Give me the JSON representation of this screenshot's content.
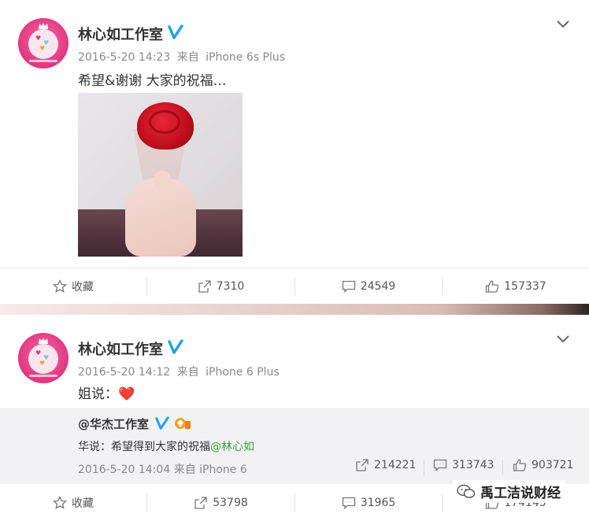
{
  "post1": {
    "author": "林心如工作室",
    "timestamp": "2016-5-20 14:23",
    "via_label": "来自",
    "device": "iPhone 6s Plus",
    "text": "希望&谢谢 大家的祝福…",
    "photo_icon": "rose-photo",
    "actions": {
      "favorite_label": "收藏",
      "repost_count": "7310",
      "comment_count": "24549",
      "like_count": "157337"
    }
  },
  "post2": {
    "author": "林心如工作室",
    "timestamp": "2016-5-20 14:12",
    "via_label": "来自",
    "device": "iPhone 6 Plus",
    "text": "姐说：",
    "emoji": "❤️",
    "quote": {
      "author": "@华杰工作室",
      "text_prefix": "华说：希望得到大家的祝福",
      "mention": "@林心如",
      "timestamp": "2016-5-20 14:04",
      "via_label": "来自",
      "device": "iPhone 6",
      "repost_count": "214221",
      "comment_count": "313743",
      "like_count": "903721"
    },
    "actions": {
      "favorite_label": "收藏",
      "repost_count": "53798",
      "comment_count": "31965",
      "like_count": "174143"
    }
  },
  "watermark": {
    "label": "禹工洁说财经"
  },
  "colors": {
    "verified_blue": "#1da1f2",
    "mention_green": "#3a9f40",
    "avatar_pink": "#e2367f"
  }
}
